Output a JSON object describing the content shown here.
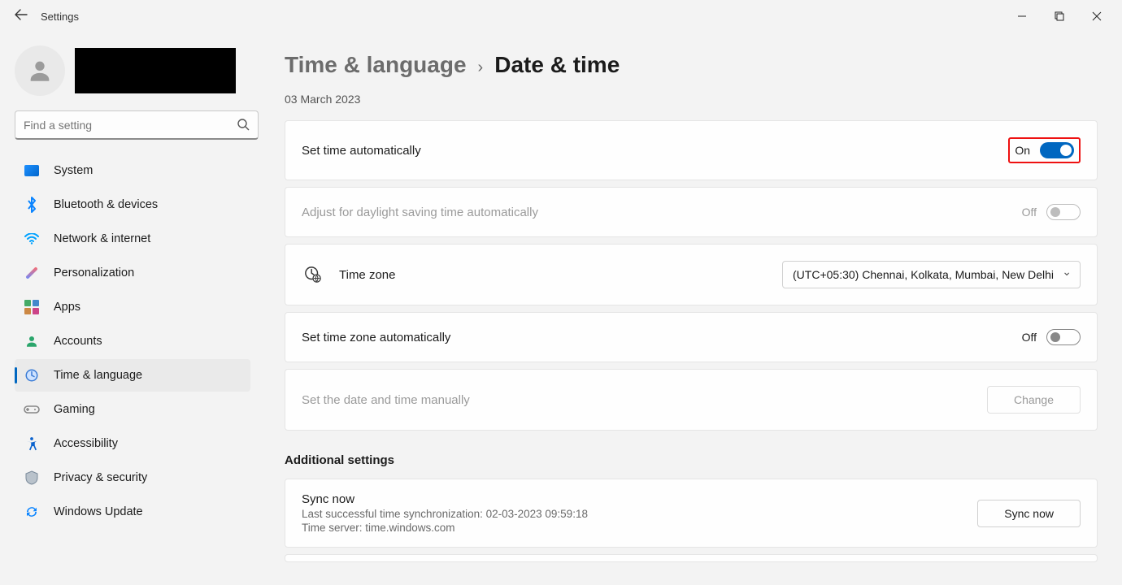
{
  "titlebar": {
    "app_title": "Settings"
  },
  "search": {
    "placeholder": "Find a setting"
  },
  "sidebar": {
    "items": [
      {
        "label": "System"
      },
      {
        "label": "Bluetooth & devices"
      },
      {
        "label": "Network & internet"
      },
      {
        "label": "Personalization"
      },
      {
        "label": "Apps"
      },
      {
        "label": "Accounts"
      },
      {
        "label": "Time & language"
      },
      {
        "label": "Gaming"
      },
      {
        "label": "Accessibility"
      },
      {
        "label": "Privacy & security"
      },
      {
        "label": "Windows Update"
      }
    ]
  },
  "breadcrumb": {
    "parent": "Time & language",
    "sep": "›",
    "current": "Date & time"
  },
  "date_string": "03 March 2023",
  "rows": {
    "set_time_auto": {
      "label": "Set time automatically",
      "state": "On"
    },
    "dst_auto": {
      "label": "Adjust for daylight saving time automatically",
      "state": "Off"
    },
    "time_zone": {
      "label": "Time zone",
      "value": "(UTC+05:30) Chennai, Kolkata, Mumbai, New Delhi"
    },
    "set_tz_auto": {
      "label": "Set time zone automatically",
      "state": "Off"
    },
    "set_manual": {
      "label": "Set the date and time manually",
      "button": "Change"
    }
  },
  "additional": {
    "heading": "Additional settings",
    "sync": {
      "title": "Sync now",
      "last": "Last successful time synchronization: 02-03-2023 09:59:18",
      "server": "Time server: time.windows.com",
      "button": "Sync now"
    }
  }
}
